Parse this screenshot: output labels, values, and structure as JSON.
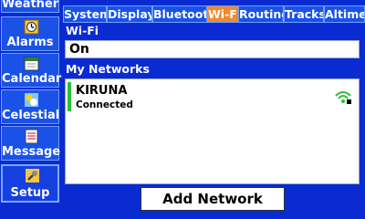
{
  "sidebar": {
    "items": [
      {
        "label": "Weather",
        "icon": "weather-icon"
      },
      {
        "label": "Alarms",
        "icon": "alarm-clock-icon"
      },
      {
        "label": "Calendar",
        "icon": "calendar-icon"
      },
      {
        "label": "Celestial",
        "icon": "sun-moon-icon"
      },
      {
        "label": "Message",
        "icon": "message-icon"
      },
      {
        "label": "Setup",
        "icon": "wrench-icon"
      }
    ]
  },
  "tabs": [
    {
      "label": "System"
    },
    {
      "label": "Display"
    },
    {
      "label": "Bluetooth"
    },
    {
      "label": "Wi-Fi"
    },
    {
      "label": "Routing"
    },
    {
      "label": "Tracks"
    },
    {
      "label": "Altime"
    }
  ],
  "wifi": {
    "section_label": "Wi-Fi",
    "value": "On"
  },
  "networks": {
    "section_label": "My Networks",
    "items": [
      {
        "name": "KIRUNA",
        "status": "Connected",
        "icon": "wifi-secure-icon"
      }
    ]
  },
  "add_button_label": "Add Network",
  "colors": {
    "background": "#0a2bd1",
    "active_tab": "#f08a2c",
    "connected_bar": "#2bbf3a",
    "signal": "#2bbf3a"
  }
}
